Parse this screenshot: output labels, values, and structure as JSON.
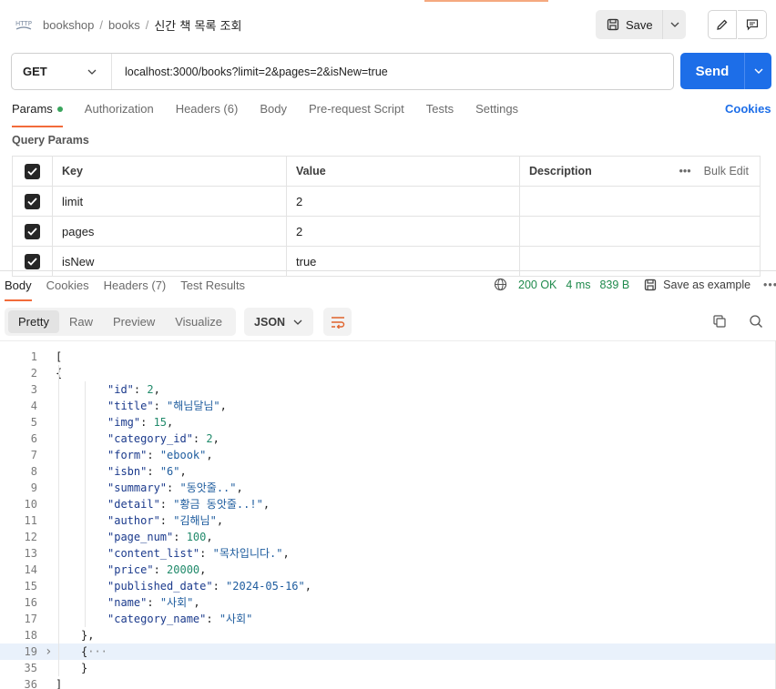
{
  "header": {
    "breadcrumb": [
      "bookshop",
      "books"
    ],
    "title": "신간 책 목록 조회",
    "save_label": "Save"
  },
  "request": {
    "method": "GET",
    "url": "localhost:3000/books?limit=2&pages=2&isNew=true",
    "send_label": "Send"
  },
  "request_tabs": [
    "Params",
    "Authorization",
    "Headers (6)",
    "Body",
    "Pre-request Script",
    "Tests",
    "Settings"
  ],
  "cookies_label": "Cookies",
  "query_params": {
    "title": "Query Params",
    "headers": {
      "key": "Key",
      "value": "Value",
      "description": "Description",
      "bulk_edit": "Bulk Edit"
    },
    "rows": [
      {
        "key": "limit",
        "value": "2",
        "checked": true
      },
      {
        "key": "pages",
        "value": "2",
        "checked": true
      },
      {
        "key": "isNew",
        "value": "true",
        "checked": true
      }
    ]
  },
  "response": {
    "tabs": [
      "Body",
      "Cookies",
      "Headers (7)",
      "Test Results"
    ],
    "status": "200 OK",
    "time": "4 ms",
    "size": "839 B",
    "save_example": "Save as example",
    "format_options": [
      "Pretty",
      "Raw",
      "Preview",
      "Visualize"
    ],
    "format": "JSON"
  },
  "code_lines": [
    {
      "n": "1",
      "text": "["
    },
    {
      "n": "2",
      "text": "{"
    },
    {
      "n": "3",
      "key": "\"id\"",
      "val": "2",
      "type": "num"
    },
    {
      "n": "4",
      "key": "\"title\"",
      "val": "\"해님달님\"",
      "type": "str"
    },
    {
      "n": "5",
      "key": "\"img\"",
      "val": "15",
      "type": "num"
    },
    {
      "n": "6",
      "key": "\"category_id\"",
      "val": "2",
      "type": "num"
    },
    {
      "n": "7",
      "key": "\"form\"",
      "val": "\"ebook\"",
      "type": "str"
    },
    {
      "n": "8",
      "key": "\"isbn\"",
      "val": "\"6\"",
      "type": "str"
    },
    {
      "n": "9",
      "key": "\"summary\"",
      "val": "\"동앗줄..\"",
      "type": "str"
    },
    {
      "n": "10",
      "key": "\"detail\"",
      "val": "\"황금 동앗줄..!\"",
      "type": "str"
    },
    {
      "n": "11",
      "key": "\"author\"",
      "val": "\"김해님\"",
      "type": "str"
    },
    {
      "n": "12",
      "key": "\"page_num\"",
      "val": "100",
      "type": "num"
    },
    {
      "n": "13",
      "key": "\"content_list\"",
      "val": "\"목차입니다.\"",
      "type": "str"
    },
    {
      "n": "14",
      "key": "\"price\"",
      "val": "20000",
      "type": "num"
    },
    {
      "n": "15",
      "key": "\"published_date\"",
      "val": "\"2024-05-16\"",
      "type": "str"
    },
    {
      "n": "16",
      "key": "\"name\"",
      "val": "\"사회\"",
      "type": "str"
    },
    {
      "n": "17",
      "key": "\"category_name\"",
      "val": "\"사회\"",
      "type": "str",
      "last": true
    },
    {
      "n": "18",
      "text": "},",
      "indent": 1
    },
    {
      "n": "19",
      "text": "{···",
      "indent": 1,
      "collapsed": true
    },
    {
      "n": "35",
      "text": "}",
      "indent": 1
    },
    {
      "n": "36",
      "text": "]"
    }
  ]
}
